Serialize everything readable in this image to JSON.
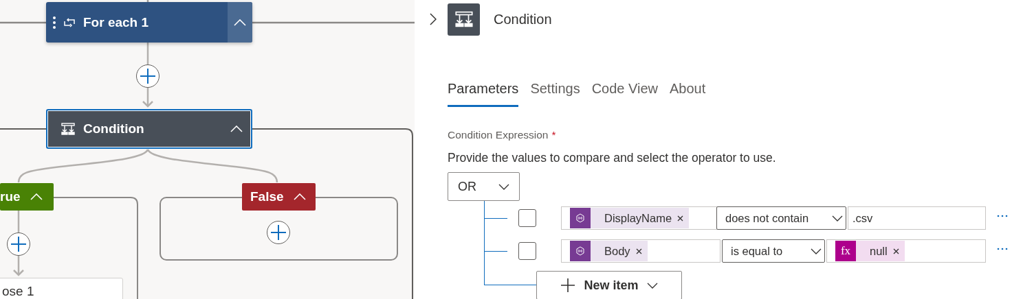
{
  "canvas": {
    "loop_node": {
      "title": "For each 1",
      "expanded": true
    },
    "condition_node": {
      "title": "Condition",
      "selected": true,
      "expanded": true
    },
    "branches": [
      {
        "kind": "true",
        "label": "rue",
        "expanded": true
      },
      {
        "kind": "false",
        "label": "False",
        "expanded": true
      }
    ],
    "true_branch_action": {
      "title": "ose 1"
    }
  },
  "panel": {
    "title": "Condition",
    "tabs": [
      {
        "label": "Parameters",
        "selected": true
      },
      {
        "label": "Settings",
        "selected": false
      },
      {
        "label": "Code View",
        "selected": false
      },
      {
        "label": "About",
        "selected": false
      }
    ],
    "field_label": "Condition Expression",
    "required_mark": "*",
    "hint": "Provide the values to compare and select the operator to use.",
    "group_operator": "OR",
    "rows": [
      {
        "checked": false,
        "left": {
          "kind": "dynamic",
          "label": "DisplayName"
        },
        "operator": "does not contain",
        "right": {
          "kind": "text",
          "value": ".csv"
        }
      },
      {
        "checked": false,
        "left": {
          "kind": "dynamic",
          "label": "Body"
        },
        "operator": "is equal to",
        "right": {
          "kind": "expression",
          "icon_text": "fx",
          "label": "null"
        }
      }
    ],
    "add_button": "New item"
  }
}
